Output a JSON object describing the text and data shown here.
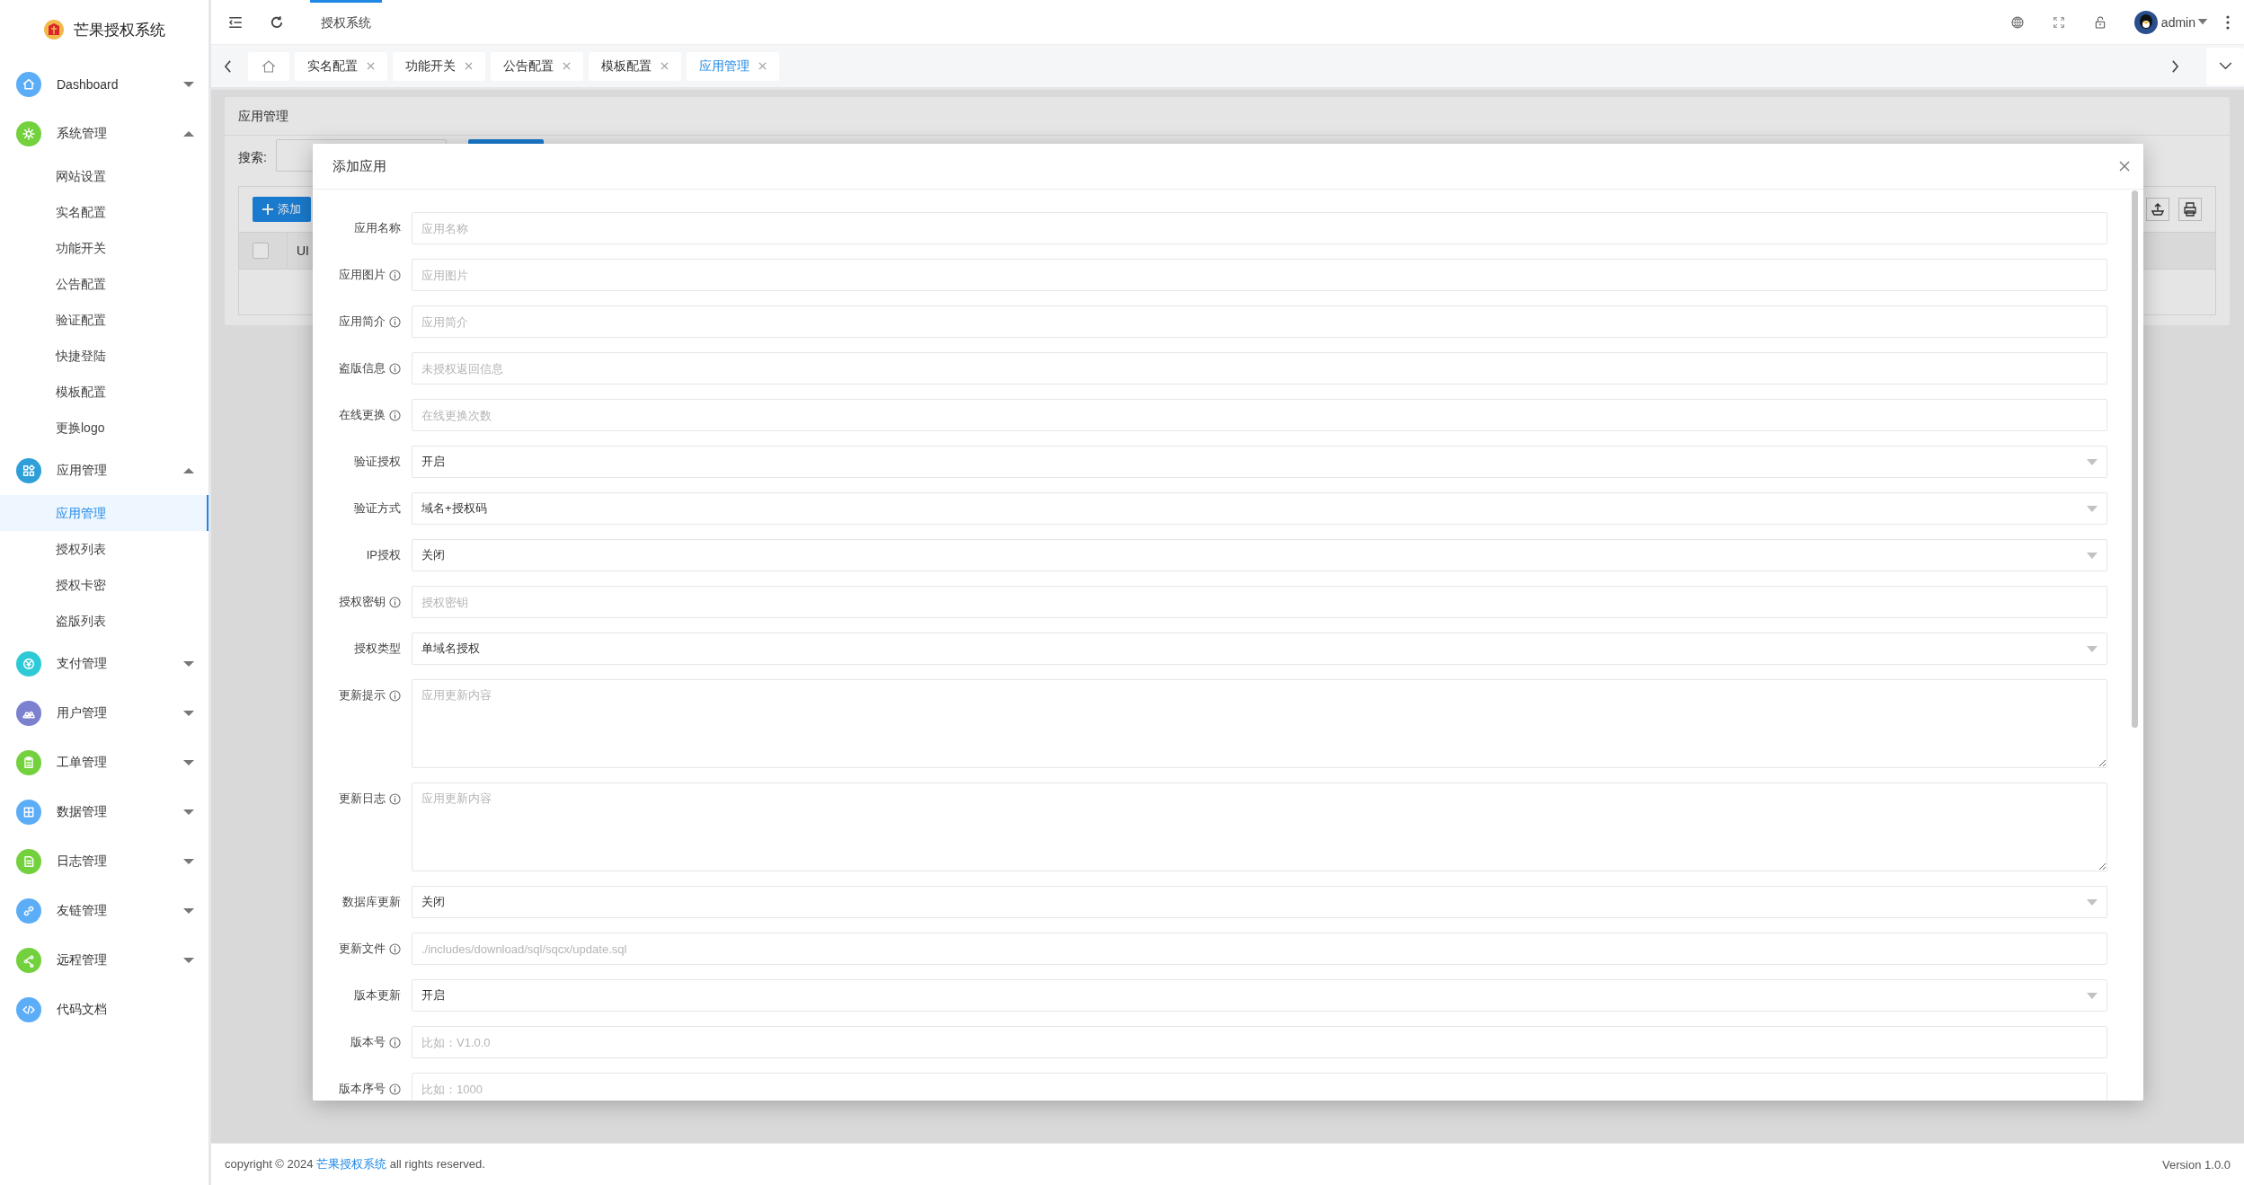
{
  "sidebar": {
    "logo": "芒果授权系统",
    "items": [
      {
        "label": "Dashboard",
        "color": "#5cadf7",
        "expanded": false
      },
      {
        "label": "系统管理",
        "color": "#73d13d",
        "expanded": true,
        "children": [
          {
            "label": "网站设置",
            "selected": false
          },
          {
            "label": "实名配置",
            "selected": false
          },
          {
            "label": "功能开关",
            "selected": false
          },
          {
            "label": "公告配置",
            "selected": false
          },
          {
            "label": "验证配置",
            "selected": false
          },
          {
            "label": "快捷登陆",
            "selected": false
          },
          {
            "label": "模板配置",
            "selected": false
          },
          {
            "label": "更换logo",
            "selected": false
          }
        ]
      },
      {
        "label": "应用管理",
        "color": "#2f9fd9",
        "expanded": true,
        "children": [
          {
            "label": "应用管理",
            "selected": true
          },
          {
            "label": "授权列表",
            "selected": false
          },
          {
            "label": "授权卡密",
            "selected": false
          },
          {
            "label": "盗版列表",
            "selected": false
          }
        ]
      },
      {
        "label": "支付管理",
        "color": "#2dcad6",
        "expanded": false
      },
      {
        "label": "用户管理",
        "color": "#7b81cf",
        "expanded": false
      },
      {
        "label": "工单管理",
        "color": "#73d13d",
        "expanded": false
      },
      {
        "label": "数据管理",
        "color": "#5cadf7",
        "expanded": false
      },
      {
        "label": "日志管理",
        "color": "#73d13d",
        "expanded": false
      },
      {
        "label": "友链管理",
        "color": "#5cadf7",
        "expanded": false
      },
      {
        "label": "远程管理",
        "color": "#73d13d",
        "expanded": false
      },
      {
        "label": "代码文档",
        "color": "#5cadf7"
      }
    ]
  },
  "topbar": {
    "nav_tabs": [
      {
        "label": "授权系统",
        "selected": true
      }
    ],
    "user": "admin"
  },
  "page_tabs": [
    {
      "label": "实名配置",
      "selected": false
    },
    {
      "label": "功能开关",
      "selected": false
    },
    {
      "label": "公告配置",
      "selected": false
    },
    {
      "label": "模板配置",
      "selected": false
    },
    {
      "label": "应用管理",
      "selected": true
    }
  ],
  "card": {
    "title": "应用管理",
    "search_label": "搜索:",
    "add_button": "添加",
    "header_checkbox": {
      "checked": false
    },
    "table_columns": [
      "UI"
    ]
  },
  "dialog": {
    "title": "添加应用",
    "fields": [
      {
        "label": "应用名称",
        "info": false,
        "kind": "input",
        "placeholder": "应用名称"
      },
      {
        "label": "应用图片",
        "info": true,
        "kind": "input",
        "placeholder": "应用图片"
      },
      {
        "label": "应用简介",
        "info": true,
        "kind": "input",
        "placeholder": "应用简介"
      },
      {
        "label": "盗版信息",
        "info": true,
        "kind": "input",
        "placeholder": "未授权返回信息"
      },
      {
        "label": "在线更换",
        "info": true,
        "kind": "input",
        "placeholder": "在线更换次数"
      },
      {
        "label": "验证授权",
        "info": false,
        "kind": "select",
        "value": "开启"
      },
      {
        "label": "验证方式",
        "info": false,
        "kind": "select",
        "value": "域名+授权码"
      },
      {
        "label": "IP授权",
        "info": false,
        "kind": "select",
        "value": "关闭"
      },
      {
        "label": "授权密钥",
        "info": true,
        "kind": "input",
        "placeholder": "授权密钥"
      },
      {
        "label": "授权类型",
        "info": false,
        "kind": "select",
        "value": "单域名授权"
      },
      {
        "label": "更新提示",
        "info": true,
        "kind": "textarea",
        "placeholder": "应用更新内容"
      },
      {
        "label": "更新日志",
        "info": true,
        "kind": "textarea",
        "placeholder": "应用更新内容"
      },
      {
        "label": "数据库更新",
        "info": false,
        "kind": "select",
        "value": "关闭"
      },
      {
        "label": "更新文件",
        "info": true,
        "kind": "input",
        "placeholder": "./includes/download/sql/sqcx/update.sql"
      },
      {
        "label": "版本更新",
        "info": false,
        "kind": "select",
        "value": "开启"
      },
      {
        "label": "版本号",
        "info": true,
        "kind": "input",
        "placeholder": "比如：V1.0.0"
      },
      {
        "label": "版本序号",
        "info": true,
        "kind": "input",
        "placeholder": "比如：1000"
      }
    ]
  },
  "footer": {
    "copyright_prefix": "copyright © 2024 ",
    "copyright_link": "芒果授权系统",
    "copyright_suffix": " all rights reserved.",
    "version": "Version 1.0.0"
  }
}
